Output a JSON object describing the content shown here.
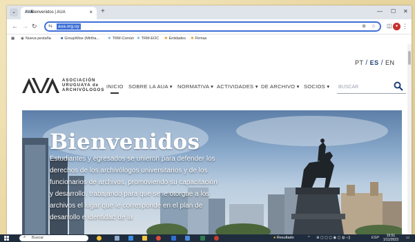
{
  "browser": {
    "tab_title": "Bienvenidos | AUA",
    "tab_favicon": "AVA",
    "url": "aua.org.uy",
    "new_tab_glyph": "+"
  },
  "bookmarks": [
    {
      "label": "Nueva pestaña",
      "icon": "globe-icon",
      "color": "#555555"
    },
    {
      "label": "GroupWise (Mirtha...",
      "icon": "mail-icon",
      "color": "#2a5fb0"
    },
    {
      "label": "TRM-Común",
      "icon": "gear-icon",
      "color": "#3c8fd0"
    },
    {
      "label": "TRM-EOC",
      "icon": "gear-icon",
      "color": "#3c8fd0"
    },
    {
      "label": "Entidades",
      "icon": "star-icon",
      "color": "#e0a020"
    },
    {
      "label": "Firmas",
      "icon": "star-icon",
      "color": "#e0a020"
    }
  ],
  "languages": {
    "pt": "PT",
    "es": "ES",
    "en": "EN",
    "separator": "/"
  },
  "logo": {
    "line1": "ASOCIACIÓN",
    "line2": "URUGUAYA de",
    "line3": "ARCHIVÓLOGOS"
  },
  "menu": [
    {
      "label": "INICIO"
    },
    {
      "label": "SOBRE LA AUA ▾"
    },
    {
      "label": "NORMATIVA ▾"
    },
    {
      "label": "ACTIVIDADES ▾"
    },
    {
      "label": "DE ARCHIVO ▾"
    },
    {
      "label": "SOCIOS ▾"
    }
  ],
  "search": {
    "placeholder": "BUSCAR"
  },
  "hero": {
    "title": "Bienvenidos",
    "body": "Estudiantes y egresados se unieron para defender los derechos de los archivólogos universitarios y de los funcionarios de archivos, promoviendo su capacitación y desarrollo, trabajando para que se le otorgue a los archivos el lugar que le corresponde en el plan de desarrollo e identidad de la"
  },
  "taskbar": {
    "search_label": "Buscar",
    "result_label": "Resultado",
    "language": "ESP",
    "time": "15:51",
    "date": "1/11/2023"
  },
  "colors": {
    "accent": "#1c3d7a",
    "omnibox_border": "#3d6fd6",
    "taskbar": "#1f2c3d"
  }
}
